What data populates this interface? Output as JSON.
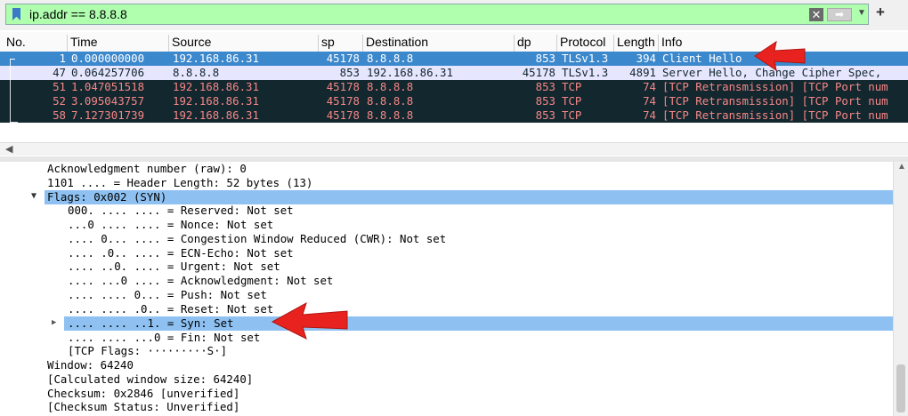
{
  "filter": {
    "value": "ip.addr == 8.8.8.8",
    "clear_icon": "x-icon",
    "apply_icon": "arrow-right-icon",
    "dropdown_icon": "chevron-down-icon",
    "add_label": "+"
  },
  "columns": [
    "No.",
    "Time",
    "Source",
    "sp",
    "Destination",
    "dp",
    "Protocol",
    "Length",
    "Info"
  ],
  "packets": [
    {
      "no": "1",
      "time": "0.000000000",
      "src": "192.168.86.31",
      "sp": "45178",
      "dst": "8.8.8.8",
      "dp": "853",
      "proto": "TLSv1.3",
      "len": "394",
      "info": "Client Hello",
      "style": "selected"
    },
    {
      "no": "47",
      "time": "0.064257706",
      "src": "8.8.8.8",
      "sp": "853",
      "dst": "192.168.86.31",
      "dp": "45178",
      "proto": "TLSv1.3",
      "len": "4891",
      "info": "Server Hello, Change Cipher Spec,",
      "style": "tls"
    },
    {
      "no": "51",
      "time": "1.047051518",
      "src": "192.168.86.31",
      "sp": "45178",
      "dst": "8.8.8.8",
      "dp": "853",
      "proto": "TCP",
      "len": "74",
      "info": "[TCP Retransmission] [TCP Port num",
      "style": "bad"
    },
    {
      "no": "52",
      "time": "3.095043757",
      "src": "192.168.86.31",
      "sp": "45178",
      "dst": "8.8.8.8",
      "dp": "853",
      "proto": "TCP",
      "len": "74",
      "info": "[TCP Retransmission] [TCP Port num",
      "style": "bad"
    },
    {
      "no": "58",
      "time": "7.127301739",
      "src": "192.168.86.31",
      "sp": "45178",
      "dst": "8.8.8.8",
      "dp": "853",
      "proto": "TCP",
      "len": "74",
      "info": "[TCP Retransmission] [TCP Port num",
      "style": "bad"
    }
  ],
  "details": [
    {
      "text": "Acknowledgment number (raw): 0",
      "indent": 1
    },
    {
      "text": "1101 .... = Header Length: 52 bytes (13)",
      "indent": 1
    },
    {
      "text": "Flags: 0x002 (SYN)",
      "indent": 1,
      "expanded": true,
      "highlight": true
    },
    {
      "text": "000. .... .... = Reserved: Not set",
      "indent": 2
    },
    {
      "text": "...0 .... .... = Nonce: Not set",
      "indent": 2
    },
    {
      "text": ".... 0... .... = Congestion Window Reduced (CWR): Not set",
      "indent": 2
    },
    {
      "text": ".... .0.. .... = ECN-Echo: Not set",
      "indent": 2
    },
    {
      "text": ".... ..0. .... = Urgent: Not set",
      "indent": 2
    },
    {
      "text": ".... ...0 .... = Acknowledgment: Not set",
      "indent": 2
    },
    {
      "text": ".... .... 0... = Push: Not set",
      "indent": 2
    },
    {
      "text": ".... .... .0.. = Reset: Not set",
      "indent": 2
    },
    {
      "text": ".... .... ..1. = Syn: Set",
      "indent": 2,
      "collapsed": true,
      "highlight": true
    },
    {
      "text": ".... .... ...0 = Fin: Not set",
      "indent": 2
    },
    {
      "text": "[TCP Flags: ·········S·]",
      "indent": 2
    },
    {
      "text": "Window: 64240",
      "indent": 1
    },
    {
      "text": "[Calculated window size: 64240]",
      "indent": 1
    },
    {
      "text": "Checksum: 0x2846 [unverified]",
      "indent": 1
    },
    {
      "text": "[Checksum Status: Unverified]",
      "indent": 1
    }
  ],
  "annotations": {
    "arrow_color": "#e8231f",
    "arrow_icon": "red-arrow-left-icon"
  },
  "colors": {
    "selected": "#3c88cc",
    "tls": "#e7e6ff",
    "bad": "#12272e",
    "bad_text": "#f78787",
    "filter_bg": "#afffaf",
    "detail_highlight": "#8ec1f1"
  }
}
